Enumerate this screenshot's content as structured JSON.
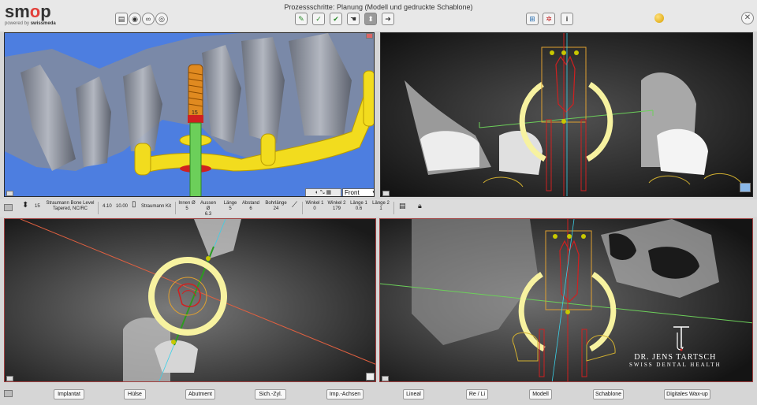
{
  "app": {
    "logo": "smop",
    "logo_sub_prefix": "powered by",
    "logo_sub_brand": "swissmeda",
    "title": "Prozessschritte: Planung (Modell und gedruckte Schablone)"
  },
  "toolbar_left": [
    {
      "name": "list-icon",
      "glyph": "▤"
    },
    {
      "name": "implant-library-icon",
      "glyph": "◉"
    },
    {
      "name": "glasses-icon",
      "glyph": "∞"
    },
    {
      "name": "camera-icon",
      "glyph": "◎"
    }
  ],
  "toolbar_center": [
    {
      "name": "step-edit-icon",
      "glyph": "✎",
      "active": false
    },
    {
      "name": "step-check-icon",
      "glyph": "✓",
      "active": false
    },
    {
      "name": "step-confirm-icon",
      "glyph": "✔",
      "active": false
    },
    {
      "name": "step-hand-icon",
      "glyph": "☚",
      "active": false
    },
    {
      "name": "step-implant-icon",
      "glyph": "⬍",
      "active": true
    },
    {
      "name": "step-export-icon",
      "glyph": "➜",
      "active": false
    }
  ],
  "toolbar_right": [
    {
      "name": "layout-icon",
      "glyph": "⊞"
    },
    {
      "name": "settings-gear-icon",
      "glyph": "✲"
    },
    {
      "name": "info-icon",
      "glyph": "i"
    }
  ],
  "view3d": {
    "orientation_select": "Front",
    "implant_label": "15"
  },
  "implant_info": {
    "position": "15",
    "name_line1": "Straumann Bone Level",
    "name_line2": "Tapered, NC/RC",
    "diameter": "4.10",
    "length": "10.00",
    "kit": "Straumann Kit",
    "fields": [
      {
        "label": "Innen Ø",
        "value": "5"
      },
      {
        "label": "Aussen Ø",
        "value": "6.3"
      },
      {
        "label": "Länge",
        "value": "5"
      },
      {
        "label": "Abstand",
        "value": "6"
      },
      {
        "label": "Bohrlänge",
        "value": "24"
      }
    ],
    "angles": [
      {
        "label": "Winkel 1",
        "value": "0"
      },
      {
        "label": "Winkel 2",
        "value": "179"
      },
      {
        "label": "Länge 1",
        "value": "0.6"
      },
      {
        "label": "Länge 2",
        "value": "1"
      }
    ]
  },
  "bottom_tabs": [
    "Implantat",
    "Hülse",
    "Abutment",
    "Sich.-Zyl.",
    "Imp.-Achsen",
    "Lineal",
    "Re / Li",
    "Modell",
    "Schablone",
    "Digitales Wax-up"
  ],
  "brand": {
    "name": "DR. JENS TARTSCH",
    "tagline": "SWISS DENTAL HEALTH",
    "monogram": "JT"
  },
  "colors": {
    "view3d_bg": "#4d7ee0",
    "guide_yellow": "#f2dc1e",
    "implant_orange": "#e08a20",
    "sleeve_red": "#d02020",
    "axis_green": "#6ccf5a",
    "axis_cyan": "#3ad0e8",
    "accent_red": "#e2403a"
  }
}
